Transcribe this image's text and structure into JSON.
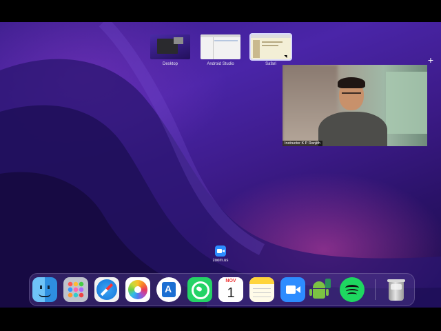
{
  "spaces": [
    {
      "label": "Desktop",
      "active": false
    },
    {
      "label": "Android Studio",
      "active": false
    },
    {
      "label": "Safari",
      "active": true
    }
  ],
  "add_space": "+",
  "video": {
    "name": "Instructor  K P Ranjith"
  },
  "desktop_app": {
    "label": "zoom.us",
    "icon": "zoom-icon"
  },
  "dock": {
    "items": [
      {
        "name": "finder",
        "icon": "finder-icon"
      },
      {
        "name": "launchpad",
        "icon": "launchpad-icon"
      },
      {
        "name": "safari",
        "icon": "safari-icon"
      },
      {
        "name": "photos",
        "icon": "photos-icon"
      },
      {
        "name": "xcode",
        "icon": "xcode-icon"
      },
      {
        "name": "whatsapp",
        "icon": "whatsapp-icon"
      },
      {
        "name": "calendar",
        "icon": "calendar-icon"
      },
      {
        "name": "notes",
        "icon": "notes-icon"
      },
      {
        "name": "zoom",
        "icon": "zoom-icon"
      },
      {
        "name": "android-studio",
        "icon": "android-icon"
      },
      {
        "name": "spotify",
        "icon": "spotify-icon"
      },
      {
        "name": "trash",
        "icon": "trash-icon"
      }
    ],
    "calendar": {
      "month": "NOV",
      "day": "1"
    }
  }
}
